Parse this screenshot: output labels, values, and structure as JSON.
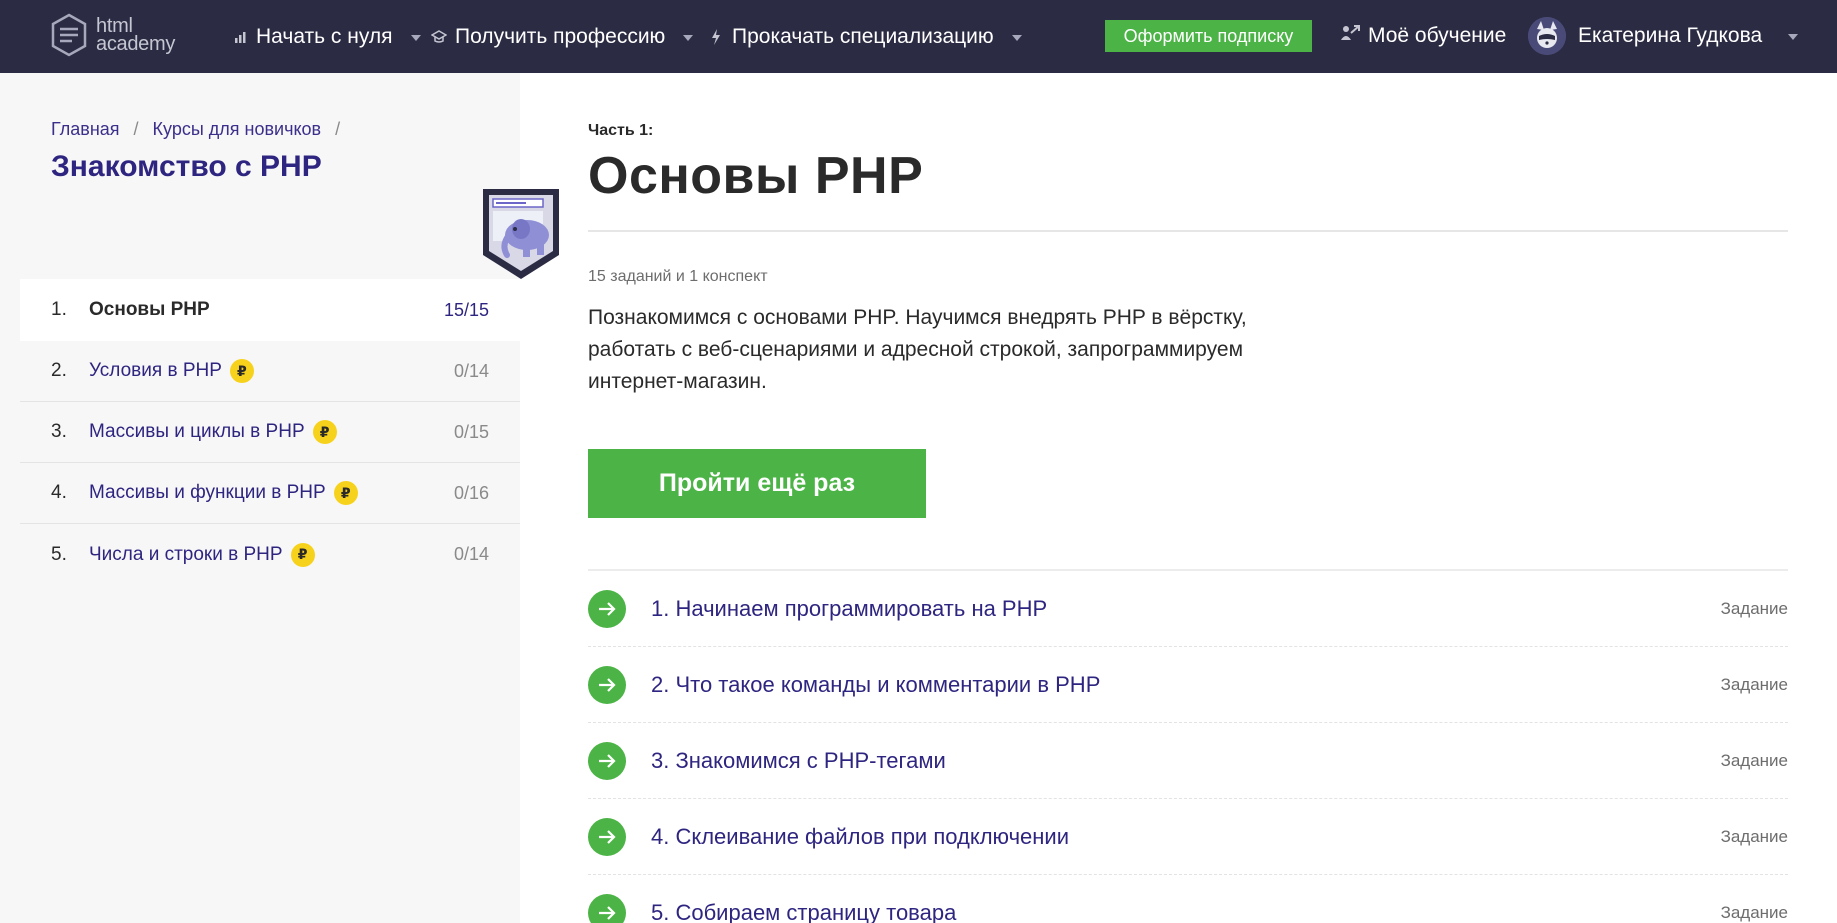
{
  "header": {
    "logo_line1": "html",
    "logo_line2": "academy",
    "nav": [
      {
        "label": "Начать с нуля",
        "icon": "bars-icon"
      },
      {
        "label": "Получить профессию",
        "icon": "graduation-cap-icon"
      },
      {
        "label": "Прокачать специализацию",
        "icon": "lightning-icon"
      }
    ],
    "subscribe_label": "Оформить подписку",
    "my_learning_label": "Моё обучение",
    "user_name": "Екатерина Гудкова"
  },
  "sidebar": {
    "breadcrumb": [
      "Главная",
      "Курсы для новичков"
    ],
    "course_title": "Знакомство с PHP",
    "parts": [
      {
        "num": "1.",
        "title": "Основы PHP",
        "count": "15/15",
        "paid": false,
        "active": true
      },
      {
        "num": "2.",
        "title": "Условия в PHP",
        "count": "0/14",
        "paid": true,
        "active": false
      },
      {
        "num": "3.",
        "title": "Массивы и циклы в PHP",
        "count": "0/15",
        "paid": true,
        "active": false
      },
      {
        "num": "4.",
        "title": "Массивы и функции в PHP",
        "count": "0/16",
        "paid": true,
        "active": false
      },
      {
        "num": "5.",
        "title": "Числа и строки в PHP",
        "count": "0/14",
        "paid": true,
        "active": false
      }
    ],
    "rub_symbol": "₽"
  },
  "main": {
    "part_label": "Часть 1:",
    "part_title": "Основы PHP",
    "meta": "15 заданий и 1 конспект",
    "description": "Познакомимся с основами PHP. Научимся внедрять PHP в вёрстку, работать с веб-сценариями и адресной строкой, запрограммируем интернет-магазин.",
    "cta_label": "Пройти ещё раз",
    "tasks": [
      {
        "title": "1. Начинаем программировать на PHP",
        "type": "Задание"
      },
      {
        "title": "2. Что такое команды и комментарии в PHP",
        "type": "Задание"
      },
      {
        "title": "3. Знакомимся с PHP-тегами",
        "type": "Задание"
      },
      {
        "title": "4. Склеивание файлов при подключении",
        "type": "Задание"
      },
      {
        "title": "5. Собираем страницу товара",
        "type": "Задание"
      }
    ]
  },
  "colors": {
    "header_bg": "#2b2b44",
    "accent_green": "#4cb446",
    "link_purple": "#2e2580",
    "coin_yellow": "#f7d21c"
  }
}
